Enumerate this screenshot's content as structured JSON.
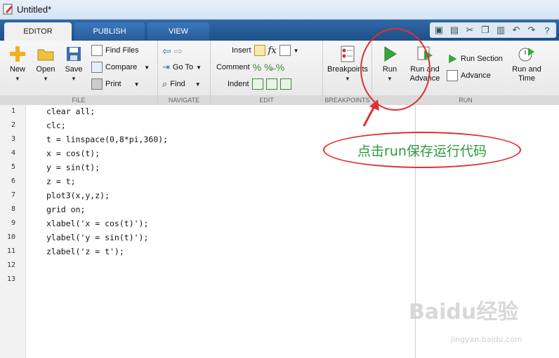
{
  "window": {
    "title": "Untitled*"
  },
  "tabs": [
    {
      "label": "EDITOR"
    },
    {
      "label": "PUBLISH"
    },
    {
      "label": "VIEW"
    }
  ],
  "ribbon": {
    "file": {
      "group_label": "FILE",
      "new_label": "New",
      "open_label": "Open",
      "save_label": "Save",
      "find_files_label": "Find Files",
      "compare_label": "Compare",
      "print_label": "Print"
    },
    "navigate": {
      "group_label": "NAVIGATE",
      "goto_label": "Go To",
      "find_label": "Find"
    },
    "edit": {
      "group_label": "EDIT",
      "insert_label": "Insert",
      "comment_label": "Comment",
      "indent_label": "Indent"
    },
    "breakpoints": {
      "group_label": "BREAKPOINTS",
      "breakpoints_label": "Breakpoints"
    },
    "run": {
      "group_label": "RUN",
      "run_label": "Run",
      "run_advance_label_1": "Run and",
      "run_advance_label_2": "Advance",
      "run_section_label": "Run Section",
      "advance_label": "Advance",
      "run_time_label_1": "Run and",
      "run_time_label_2": "Time"
    }
  },
  "editor": {
    "line_numbers": [
      "1",
      "2",
      "3",
      "4",
      "5",
      "6",
      "7",
      "8",
      "9",
      "10",
      "11",
      "12",
      "13"
    ],
    "lines": [
      "clear all;",
      "clc;",
      "t = linspace(0,8*pi,360);",
      "x = cos(t);",
      "y = sin(t);",
      "z = t;",
      "plot3(x,y,z);",
      "grid on;",
      "xlabel('x = cos(t)');",
      "ylabel('y = sin(t)');",
      "zlabel('z = t');",
      "",
      ""
    ]
  },
  "annotation": {
    "text": "点击run保存运行代码",
    "color": "#e03030"
  },
  "watermark": {
    "brand": "Baidu经验",
    "url": "jingyan.baidu.com"
  },
  "colors": {
    "tab_bar": "#2f68a8",
    "keyword": "#a020f0",
    "run_green": "#3aa63a"
  }
}
